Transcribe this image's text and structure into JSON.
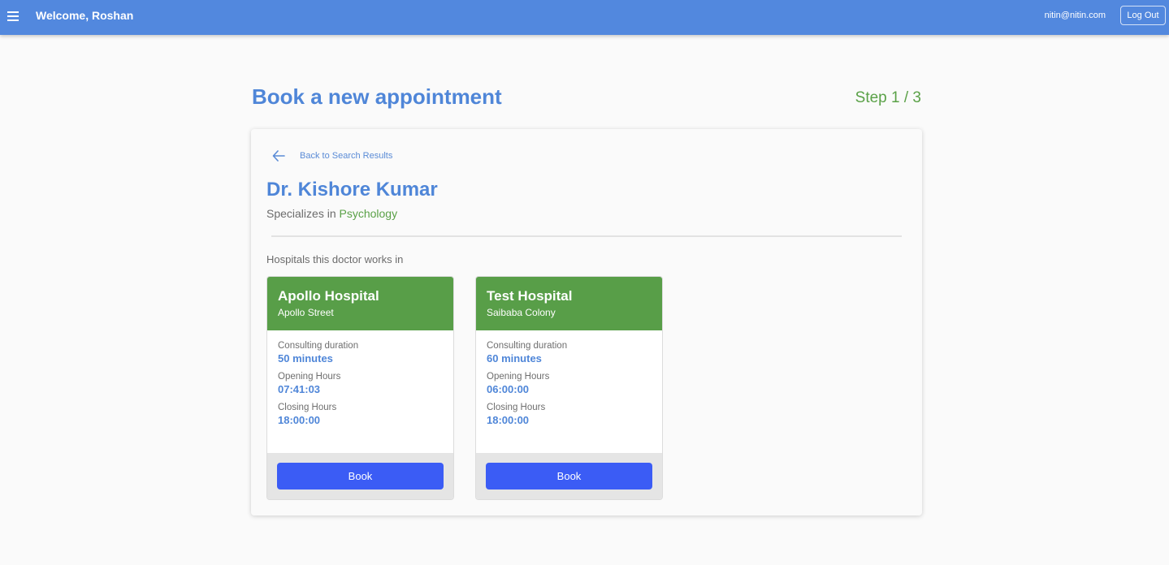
{
  "header": {
    "welcome": "Welcome, Roshan",
    "email": "nitin@nitin.com",
    "logout_label": "Log Out"
  },
  "page": {
    "title": "Book a new appointment",
    "step": "Step 1 / 3"
  },
  "doctor": {
    "back_label": "Back to Search Results",
    "name": "Dr. Kishore Kumar",
    "specializes_prefix": "Specializes in ",
    "specialty": "Psychology",
    "hospitals_label": "Hospitals this doctor works in"
  },
  "hospitals": [
    {
      "name": "Apollo Hospital",
      "street": "Apollo Street",
      "duration_label": "Consulting duration",
      "duration": "50 minutes",
      "opening_label": "Opening Hours",
      "opening": "07:41:03",
      "closing_label": "Closing Hours",
      "closing": "18:00:00",
      "book_label": "Book"
    },
    {
      "name": "Test Hospital",
      "street": "Saibaba Colony",
      "duration_label": "Consulting duration",
      "duration": "60 minutes",
      "opening_label": "Opening Hours",
      "opening": "06:00:00",
      "closing_label": "Closing Hours",
      "closing": "18:00:00",
      "book_label": "Book"
    }
  ],
  "colors": {
    "header_bg": "#5288de",
    "primary_text": "#4f86d8",
    "accent_green": "#5aa147",
    "hospital_header": "#589e48",
    "book_button": "#3b5cf5"
  },
  "icons": {
    "menu": "menu-icon",
    "back": "arrow-left-icon"
  }
}
